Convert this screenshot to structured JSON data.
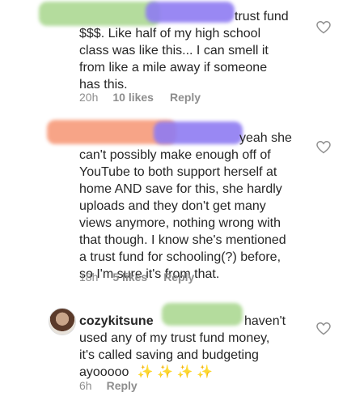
{
  "comments": [
    {
      "lines": [
        "trust fund",
        "$$$. Like half of my high school",
        "class was like this... I can smell it",
        "from like a mile away if someone",
        "has this."
      ],
      "time": "20h",
      "likes": "10 likes",
      "reply": "Reply",
      "icon": "heart-outline-icon",
      "redaction_colors": [
        "#a7d68c",
        "#8f7cf2"
      ]
    },
    {
      "lines": [
        "yeah she",
        "can't possibly make enough off of",
        "YouTube to both support herself at",
        "home AND save for this, she hardly",
        "uploads and they don't get many",
        "views anymore, nothing wrong with",
        "that though. I know she's mentioned",
        "a trust fund for schooling(?) before,",
        "so I'm sure it's from that."
      ],
      "time": "18h",
      "likes": "5 likes",
      "reply": "Reply",
      "icon": "heart-outline-icon",
      "redaction_colors": [
        "#f79b7b",
        "#8f7cf2"
      ]
    },
    {
      "username": "cozykitsune",
      "line1_tail": "haven't",
      "lines_rest": [
        "used any of my trust fund money,",
        "it's called saving and budgeting",
        "ayooooo"
      ],
      "emoji": "✨ ✨ ✨ ✨",
      "time": "6h",
      "reply": "Reply",
      "icon": "heart-outline-icon",
      "redaction_colors": [
        "#a7d68c"
      ]
    }
  ]
}
